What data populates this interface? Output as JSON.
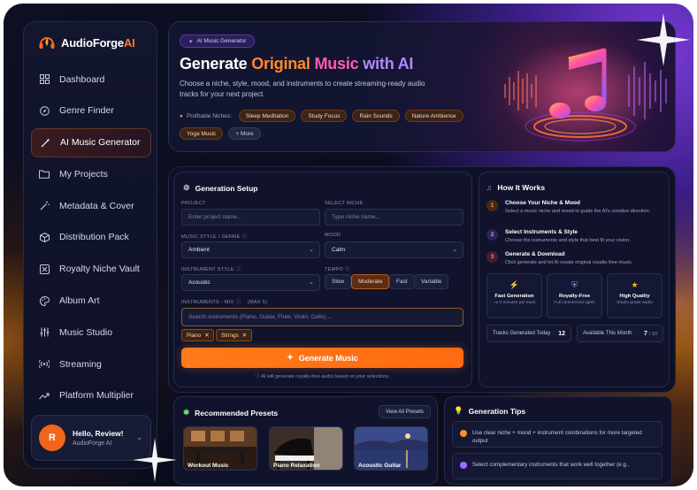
{
  "brand": {
    "name": "AudioForge",
    "suffix": "AI"
  },
  "sidebar": {
    "items": [
      {
        "label": "Dashboard",
        "icon": "grid-icon"
      },
      {
        "label": "Genre Finder",
        "icon": "compass-icon"
      },
      {
        "label": "AI Music Generator",
        "icon": "magic-wand-icon",
        "active": true
      },
      {
        "label": "My Projects",
        "icon": "folder-icon"
      },
      {
        "label": "Metadata & Cover",
        "icon": "wand-icon"
      },
      {
        "label": "Distribution Pack",
        "icon": "package-icon"
      },
      {
        "label": "Royalty Niche Vault",
        "icon": "vault-icon"
      },
      {
        "label": "Album Art",
        "icon": "palette-icon"
      },
      {
        "label": "Music Studio",
        "icon": "sliders-icon"
      },
      {
        "label": "Streaming",
        "icon": "broadcast-icon"
      },
      {
        "label": "Platform Multiplier",
        "icon": "trend-up-icon"
      }
    ],
    "user": {
      "initial": "R",
      "greeting": "Hello, Review!",
      "sub": "AudioForge AI"
    }
  },
  "hero": {
    "pill": "AI Music Generator",
    "title_parts": [
      "Generate ",
      "Original ",
      "Music ",
      "with AI"
    ],
    "description": "Choose a niche, style, mood, and instruments to create streaming-ready audio tracks for your next project.",
    "niches_label": "Profitable Niches:",
    "niches": [
      "Sleep Meditation",
      "Study Focus",
      "Rain Sounds",
      "Nature Ambience",
      "Yoga Music"
    ],
    "more_label": "+ More"
  },
  "setup": {
    "title": "Generation Setup",
    "project_label": "PROJECT",
    "project_placeholder": "Enter project name...",
    "niche_label": "SELECT NICHE",
    "niche_placeholder": "Type niche name...",
    "style_label": "MUSIC STYLE / GENRE",
    "style_value": "Ambient",
    "mood_label": "MOOD",
    "mood_value": "Calm",
    "instrument_style_label": "INSTRUMENT STYLE",
    "instrument_style_value": "Acoustic",
    "tempo_label": "TEMPO",
    "tempo_options": [
      "Slow",
      "Moderate",
      "Fast",
      "Variable"
    ],
    "tempo_selected": "Moderate",
    "instruments_label": "INSTRUMENTS - MIX",
    "instruments_max": "(MAX 5)",
    "instruments_placeholder": "Search instruments (Piano, Guitar, Flute, Violin, Cello)...",
    "instruments": [
      "Piano",
      "Strings"
    ],
    "generate_label": "Generate Music",
    "note": "AI will generate royalty-free audio based on your selections."
  },
  "how": {
    "title": "How It Works",
    "steps": [
      {
        "num": "1",
        "title": "Choose Your Niche & Mood",
        "desc": "Select a music niche and mood to guide the AI's creative direction."
      },
      {
        "num": "2",
        "title": "Select Instruments & Style",
        "desc": "Choose the instruments and style that best fit your vision."
      },
      {
        "num": "3",
        "title": "Generate & Download",
        "desc": "Click generate and let AI create original royalty-free music."
      }
    ],
    "features": [
      {
        "title": "Fast Generation",
        "sub": "~2-3 minutes per track",
        "icon": "bolt-icon"
      },
      {
        "title": "Royalty-Free",
        "sub": "Full commercial rights",
        "icon": "shield-icon"
      },
      {
        "title": "High Quality",
        "sub": "Studio-grade audio",
        "icon": "star-icon"
      }
    ],
    "stats": {
      "generated_label": "Tracks Generated Today",
      "generated_value": "12",
      "available_label": "Available This Month",
      "available_value": "7",
      "available_total": "/ 10"
    }
  },
  "presets": {
    "title": "Recommended Presets",
    "view_all": "View All Presets",
    "cards": [
      "Workout Music",
      "Piano Relaxation",
      "Acoustic Guitar"
    ]
  },
  "tips": {
    "title": "Generation Tips",
    "items": [
      "Use clear niche + mood + instrument combinations for more targeted output",
      "Select complementary instruments that work well together (e.g.,"
    ]
  },
  "colors": {
    "accent": "#ff7a1a",
    "purple": "#8a5cff",
    "bg": "#0d0f24"
  }
}
